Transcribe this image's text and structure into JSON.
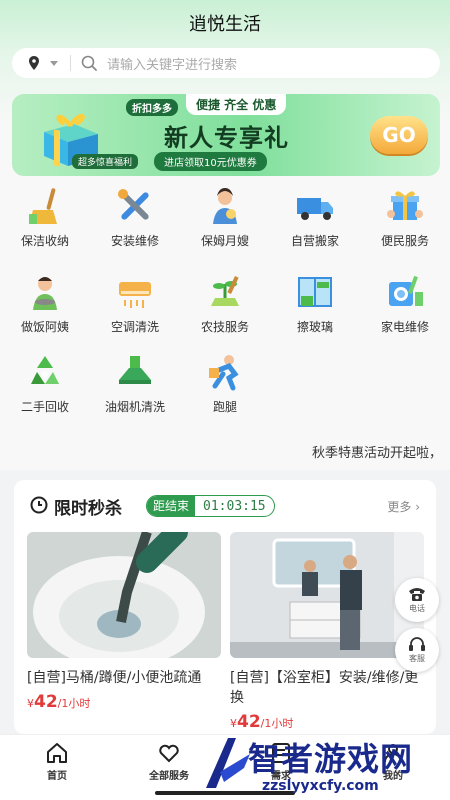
{
  "app": {
    "title": "逍悦生活"
  },
  "search": {
    "placeholder": "请输入关键字进行搜索"
  },
  "banner": {
    "tag_discount": "折扣多多",
    "tag_features": "便捷 齐全 优惠",
    "headline": "新人专享礼",
    "subtitle": "进店领取10元优惠券",
    "tag_welfare": "超多惊喜福利",
    "cta": "GO"
  },
  "categories": [
    {
      "label": "保洁收纳",
      "icon": "broom-icon"
    },
    {
      "label": "安装维修",
      "icon": "tools-icon"
    },
    {
      "label": "保姆月嫂",
      "icon": "nanny-icon"
    },
    {
      "label": "自营搬家",
      "icon": "truck-icon"
    },
    {
      "label": "便民服务",
      "icon": "gift-icon"
    },
    {
      "label": "做饭阿姨",
      "icon": "chef-icon"
    },
    {
      "label": "空调清洗",
      "icon": "air-conditioner-icon"
    },
    {
      "label": "农技服务",
      "icon": "agriculture-icon"
    },
    {
      "label": "擦玻璃",
      "icon": "window-icon"
    },
    {
      "label": "家电维修",
      "icon": "appliance-icon"
    },
    {
      "label": "二手回收",
      "icon": "recycle-icon"
    },
    {
      "label": "油烟机清洗",
      "icon": "range-hood-icon"
    },
    {
      "label": "跑腿",
      "icon": "runner-icon"
    }
  ],
  "notice": "秋季特惠活动开起啦，",
  "flash_sale": {
    "title": "限时秒杀",
    "countdown_label": "距结束",
    "countdown_time": "01:03:15",
    "more": "更多",
    "products": [
      {
        "name": "[自营]马桶/蹲便/小便池疏通",
        "price_symbol": "¥",
        "price": "42",
        "unit": "/1小时"
      },
      {
        "name": "[自营]【浴室柜】安装/维修/更换",
        "price_symbol": "¥",
        "price": "42",
        "unit": "/1小时"
      }
    ]
  },
  "floating": {
    "phone": "电话",
    "service": "客服"
  },
  "tabbar": [
    {
      "label": "首页",
      "icon": "home-icon"
    },
    {
      "label": "全部服务",
      "icon": "heart-hand-icon"
    },
    {
      "label": "需求",
      "icon": "list-icon"
    },
    {
      "label": "我的",
      "icon": "user-icon"
    }
  ],
  "watermark": {
    "text": "智者游戏网",
    "url": "zzslyyxcfy.com"
  },
  "colors": {
    "accent": "#2e9b4f",
    "price": "#e03a3a",
    "banner_bg": "#7fdf9b"
  }
}
